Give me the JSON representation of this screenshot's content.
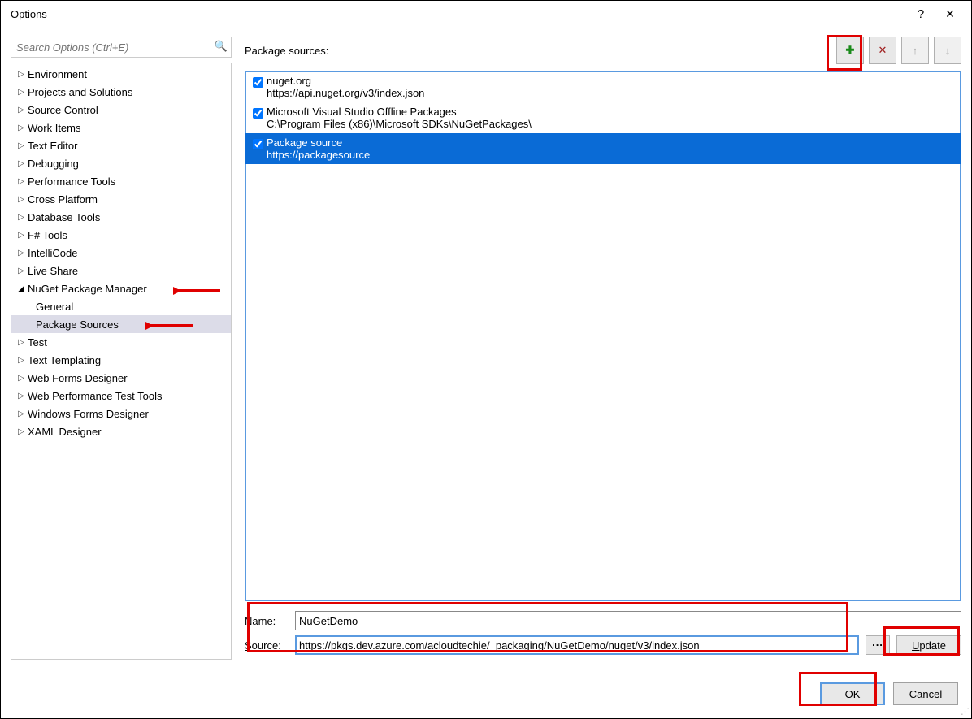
{
  "window": {
    "title": "Options",
    "help_glyph": "?",
    "close_glyph": "✕"
  },
  "search": {
    "placeholder": "Search Options (Ctrl+E)",
    "mag_glyph": "🔍"
  },
  "tree": {
    "items": [
      {
        "label": "Environment",
        "expanded": false
      },
      {
        "label": "Projects and Solutions",
        "expanded": false
      },
      {
        "label": "Source Control",
        "expanded": false
      },
      {
        "label": "Work Items",
        "expanded": false
      },
      {
        "label": "Text Editor",
        "expanded": false
      },
      {
        "label": "Debugging",
        "expanded": false
      },
      {
        "label": "Performance Tools",
        "expanded": false
      },
      {
        "label": "Cross Platform",
        "expanded": false
      },
      {
        "label": "Database Tools",
        "expanded": false
      },
      {
        "label": "F# Tools",
        "expanded": false
      },
      {
        "label": "IntelliCode",
        "expanded": false
      },
      {
        "label": "Live Share",
        "expanded": false
      },
      {
        "label": "NuGet Package Manager",
        "expanded": true,
        "children": [
          {
            "label": "General",
            "selected": false
          },
          {
            "label": "Package Sources",
            "selected": true
          }
        ]
      },
      {
        "label": "Test",
        "expanded": false
      },
      {
        "label": "Text Templating",
        "expanded": false
      },
      {
        "label": "Web Forms Designer",
        "expanded": false
      },
      {
        "label": "Web Performance Test Tools",
        "expanded": false
      },
      {
        "label": "Windows Forms Designer",
        "expanded": false
      },
      {
        "label": "XAML Designer",
        "expanded": false
      }
    ]
  },
  "main": {
    "header_label": "Package sources:",
    "toolbar": {
      "add_glyph": "✚",
      "add_color": "#1a8a1a",
      "remove_glyph": "✕",
      "remove_color": "#a02020",
      "up_glyph": "↑",
      "down_glyph": "↓"
    },
    "sources": [
      {
        "checked": true,
        "name": "nuget.org",
        "url": "https://api.nuget.org/v3/index.json",
        "selected": false
      },
      {
        "checked": true,
        "name": "Microsoft Visual Studio Offline Packages",
        "url": "C:\\Program Files (x86)\\Microsoft SDKs\\NuGetPackages\\",
        "selected": false
      },
      {
        "checked": true,
        "name": "Package source",
        "url": "https://packagesource",
        "selected": true
      }
    ],
    "edit": {
      "name_label_before": "N",
      "name_label_after": "ame:",
      "source_label_before": "S",
      "source_label_after": "ource:",
      "name_value": "NuGetDemo",
      "source_value": "https://pkgs.dev.azure.com/acloudtechie/_packaging/NuGetDemo/nuget/v3/index.json",
      "browse_label": "...",
      "update_label_before": "U",
      "update_label_after": "pdate"
    }
  },
  "footer": {
    "ok_label": "OK",
    "cancel_label": "Cancel"
  }
}
